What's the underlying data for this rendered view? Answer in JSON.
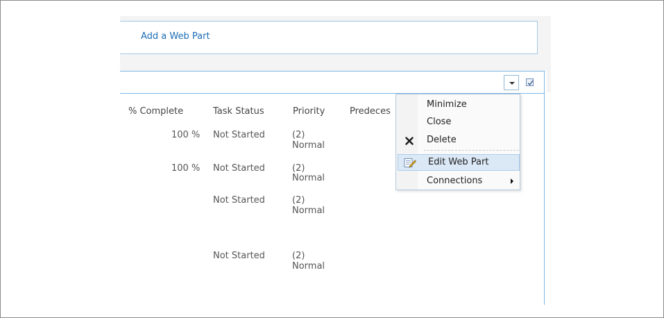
{
  "zone": {
    "add_web_part_label": "Add a Web Part"
  },
  "columns": [
    "% Complete",
    "Task Status",
    "Priority",
    "Predeces"
  ],
  "rows": [
    {
      "percent_complete": "100 %",
      "task_status": "Not Started",
      "priority_line1": "(2)",
      "priority_line2": "Normal"
    },
    {
      "percent_complete": "100 %",
      "task_status": "Not Started",
      "priority_line1": "(2)",
      "priority_line2": "Normal"
    },
    {
      "percent_complete": "",
      "task_status": "Not Started",
      "priority_line1": "(2)",
      "priority_line2": "Normal"
    },
    {
      "percent_complete": "",
      "task_status": "Not Started",
      "priority_line1": "(2)",
      "priority_line2": "Normal"
    }
  ],
  "web_part_menu": {
    "items": [
      {
        "label": "Minimize"
      },
      {
        "label": "Close"
      },
      {
        "label": "Delete",
        "icon": "delete-icon"
      },
      {
        "label": "Edit Web Part",
        "icon": "edit-web-part-icon",
        "highlighted": true
      },
      {
        "label": "Connections",
        "has_submenu": true
      }
    ]
  },
  "colors": {
    "link": "#1c6cb4",
    "chrome_border": "#7bb4e4",
    "menu_highlight": "#dbe8f6"
  }
}
